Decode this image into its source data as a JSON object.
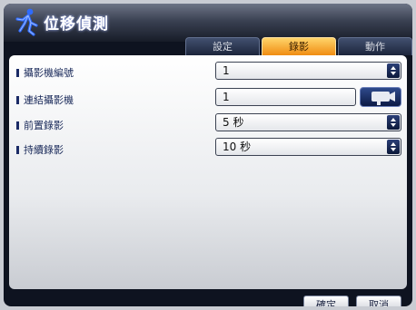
{
  "dialog": {
    "title": "位移偵測",
    "title_icon": "running-figure-icon"
  },
  "tabs": [
    {
      "label": "設定",
      "active": false
    },
    {
      "label": "錄影",
      "active": true
    },
    {
      "label": "動作",
      "active": false
    }
  ],
  "rows": [
    {
      "label": "攝影機編號",
      "value": "1",
      "control": "spinner"
    },
    {
      "label": "連結攝影機",
      "value": "1",
      "control": "camera-button"
    },
    {
      "label": "前置錄影",
      "value": "5 秒",
      "control": "spinner"
    },
    {
      "label": "持續錄影",
      "value": "10 秒",
      "control": "spinner"
    }
  ],
  "buttons": {
    "ok": "確定",
    "cancel": "取消"
  },
  "colors": {
    "active_tab": "#f5a623",
    "tab": "#2a3552",
    "frame": "#0e1320"
  }
}
